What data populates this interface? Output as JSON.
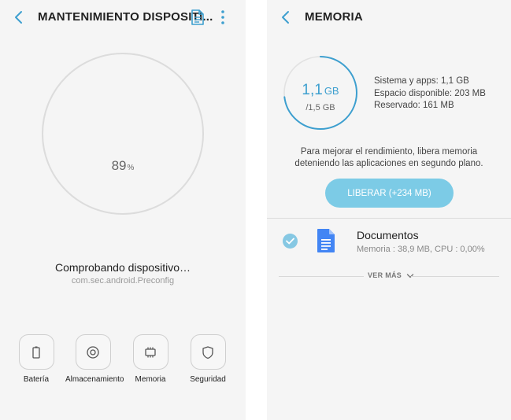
{
  "left": {
    "header": {
      "title": "MANTENIMIENTO DISPOSITI..."
    },
    "status": {
      "percent": "89",
      "percent_sign": "%",
      "checking_text": "Comprobando dispositivo…",
      "package": "com.sec.android.Preconfig"
    },
    "categories": [
      {
        "label": "Batería",
        "icon": "battery-icon"
      },
      {
        "label": "Almacenamiento",
        "icon": "storage-icon"
      },
      {
        "label": "Memoria",
        "icon": "memory-chip-icon"
      },
      {
        "label": "Seguridad",
        "icon": "shield-icon"
      }
    ]
  },
  "right": {
    "header": {
      "title": "MEMORIA"
    },
    "memory": {
      "used_value": "1,1",
      "used_unit": "GB",
      "total": "/1,5 GB",
      "used_fraction": 0.73,
      "stats": [
        "Sistema y apps: 1,1 GB",
        "Espacio disponible: 203 MB",
        "Reservado: 161 MB"
      ]
    },
    "hint": "Para mejorar el rendimiento, libera memoria deteniendo las aplicaciones en segundo plano.",
    "free_button": "LIBERAR (+234 MB)",
    "apps": [
      {
        "name": "Documentos",
        "info": "Memoria : 38,9 MB, CPU : 0,00%",
        "checked": true,
        "icon": "docs-icon"
      }
    ],
    "more_label": "VER MÁS"
  },
  "colors": {
    "accent": "#3d9fcf",
    "button": "#7ccbe6",
    "check": "#86c8e3",
    "docs_blue": "#4285f4"
  }
}
